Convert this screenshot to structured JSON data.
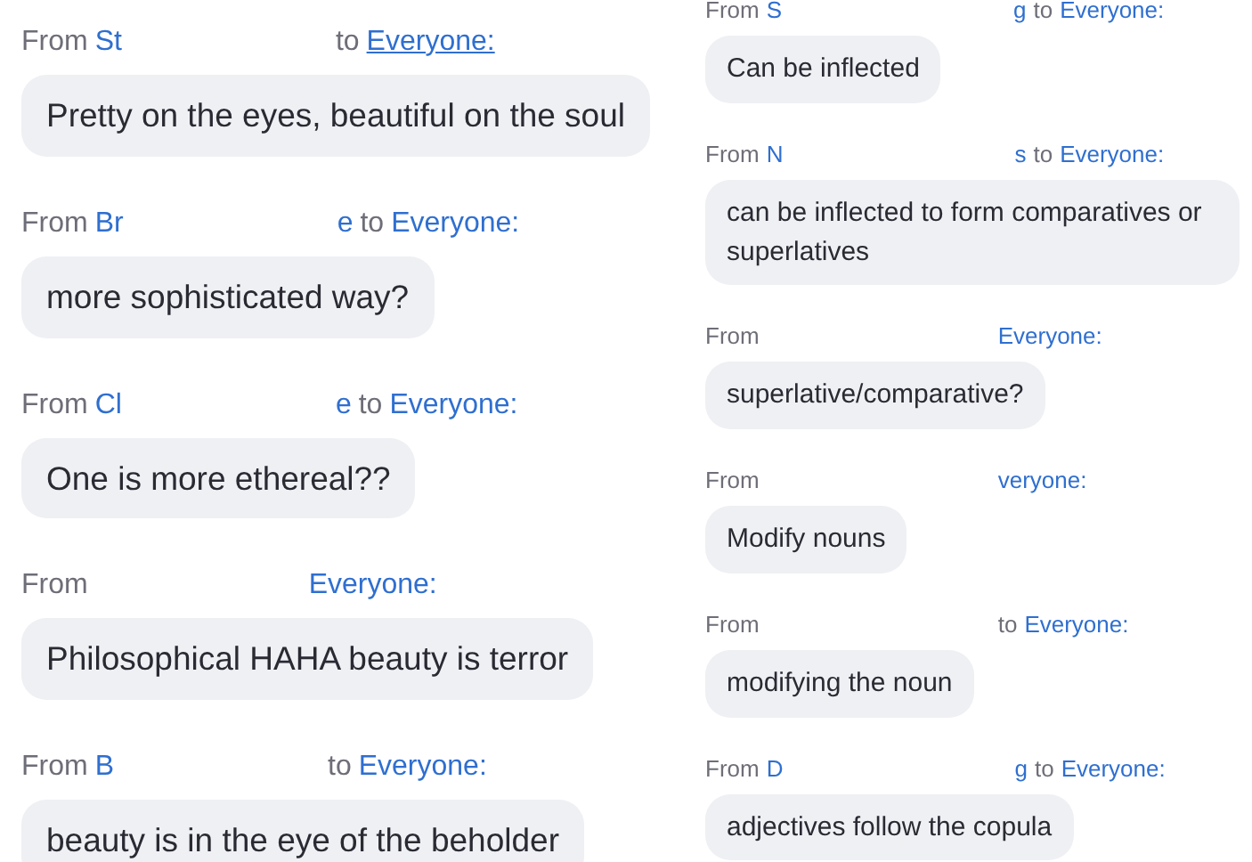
{
  "columns": [
    {
      "messages": [
        {
          "header": {
            "from": "From",
            "name_start": "St",
            "to": "to",
            "recipient": "Everyone:",
            "underlined": true
          },
          "text": "Pretty on the eyes, beautiful on the soul"
        },
        {
          "header": {
            "from": "From",
            "name_start": "Br",
            "name_end": "e",
            "to": "to",
            "recipient": "Everyone:",
            "underlined": false
          },
          "text": "more sophisticated way?"
        },
        {
          "header": {
            "from": "From",
            "name_start": "Cl",
            "name_end": "e",
            "to": "to",
            "recipient": "Everyone:",
            "underlined": false
          },
          "text": "One is more ethereal??"
        },
        {
          "header": {
            "from": "From",
            "recipient": "Everyone:",
            "underlined": false
          },
          "text": "Philosophical HAHA beauty is terror"
        },
        {
          "header": {
            "from": "From",
            "name_start": "B",
            "to": "to",
            "recipient": "Everyone:",
            "underlined": false
          },
          "text": "beauty is in the eye of the beholder"
        }
      ]
    },
    {
      "messages": [
        {
          "header": {
            "from": "From",
            "name_start": "S",
            "name_end": "g",
            "to": "to",
            "recipient": "Everyone:",
            "underlined": false
          },
          "text": "Can be inflected"
        },
        {
          "header": {
            "from": "From",
            "name_start": "N",
            "name_end": "s",
            "to": "to",
            "recipient": "Everyone:",
            "underlined": false
          },
          "text": "can be inflected to form comparatives or superlatives"
        },
        {
          "header": {
            "from": "From",
            "recipient": "Everyone:",
            "underlined": false
          },
          "text": "superlative/comparative?"
        },
        {
          "header": {
            "from": "From",
            "recipient": "veryone:",
            "underlined": false
          },
          "text": "Modify nouns"
        },
        {
          "header": {
            "from": "From",
            "to": "to",
            "recipient": "Everyone:",
            "underlined": false
          },
          "text": "modifying the noun"
        },
        {
          "header": {
            "from": "From",
            "name_start": "D",
            "name_end": "g",
            "to": "to",
            "recipient": "Everyone:",
            "underlined": false
          },
          "text": "adjectives follow the copula"
        }
      ]
    }
  ]
}
